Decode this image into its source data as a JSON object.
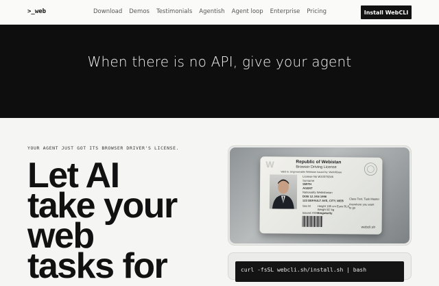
{
  "nav": {
    "logo": ">_web",
    "links": [
      "Download",
      "Demos",
      "Testimonials",
      "Agentish",
      "Agent loop",
      "Enterprise",
      "Pricing"
    ],
    "cta": "Install WebCLI"
  },
  "hero_dark": {
    "headline": "When there is no API, give your agent"
  },
  "hero": {
    "eyebrow": "YOUR AGENT JUST GOT ITS BROWSER DRIVER'S LICENSE.",
    "headline_lines": [
      "Let AI",
      "take your",
      "web",
      "tasks for"
    ]
  },
  "license_card": {
    "title": "Republic of Webistan",
    "subtitle": "Browser Driving License",
    "issued_line": "Valid in: Ungovernable Webistan     Issued by: WebcliBase",
    "license_no": "License No   W10379246",
    "name_label": "Surname",
    "name": "SMITH",
    "given": "AGENT",
    "nationality": "Nationality  Webistanian",
    "dob": "DOB  12 JAN 1996",
    "address": "123 DEFAULT AVE, CITY, WEB",
    "sex": "Sex  M",
    "height": "Height  185 cm",
    "weight": "Weight  82 kg",
    "eyes": "Eyes  BLK",
    "issued": "Issued  2026",
    "residence": "Singularity",
    "class": "Class  Text, Task Master",
    "restrictions": "Anywhere you want to go",
    "watermark": "W",
    "brand": "webcli.sh"
  },
  "terminal": {
    "command": "curl -fsSL webcli.sh/install.sh | bash"
  }
}
